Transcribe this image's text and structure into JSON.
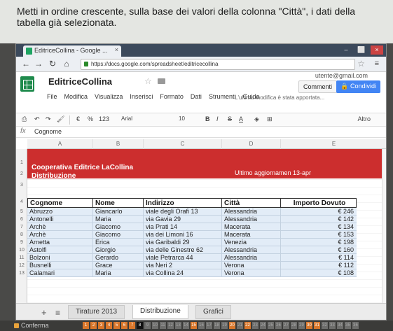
{
  "question": {
    "line1": "Metti in ordine crescente, sulla base dei valori della colonna \"Città\", i dati della",
    "line2": "tabella già selezionata."
  },
  "browser": {
    "tab_title": "EditriceCollina - Google ...",
    "tab_close": "×",
    "url": "https://docs.google.com/spreadsheet/editricecollina",
    "minimize": "–",
    "maximize": "⬜",
    "close": "×"
  },
  "docs": {
    "title": "EditriceCollina",
    "user_email": "utente@gmail.com",
    "comments_label": "Commenti",
    "share_label": "Condividi",
    "menus": [
      "File",
      "Modifica",
      "Visualizza",
      "Inserisci",
      "Formato",
      "Dati",
      "Strumenti",
      "Guida"
    ],
    "last_edit": "L'ultima modifica è stata apportata..."
  },
  "toolbar": {
    "currency": "€",
    "percent": "%",
    "number_format": "123",
    "font": "Arial",
    "size": "10",
    "bold": "B",
    "italic": "I",
    "strike": "S",
    "text_color": "A",
    "more": "Altro"
  },
  "formula_bar": {
    "fx": "fx",
    "value": "Cognome"
  },
  "grid": {
    "columns": [
      "A",
      "B",
      "C",
      "D",
      "E"
    ],
    "row_numbers": [
      "1",
      "2",
      "3",
      "4",
      "5",
      "6",
      "7",
      "8",
      "9",
      "10",
      "11",
      "12",
      "13"
    ],
    "banner_title": "Cooperativa Editrice LaCollina",
    "banner_subtitle": "Distribuzione",
    "banner_date": "Ultimo aggiornamen 13-apr",
    "headers": [
      "Cognome",
      "Nome",
      "Indirizzo",
      "Città",
      "Importo Dovuto"
    ],
    "rows": [
      [
        "Abruzzo",
        "Giancarlo",
        "viale degli Orafi 13",
        "Alessandria",
        "€ 246"
      ],
      [
        "Antonelli",
        "Maria",
        "via Gavia 29",
        "Alessandria",
        "€ 142"
      ],
      [
        "Archè",
        "Giacomo",
        "via Prati 14",
        "Macerata",
        "€ 134"
      ],
      [
        "Archè",
        "Giacomo",
        "via dei Limoni 16",
        "Macerata",
        "€ 153"
      ],
      [
        "Arnetta",
        "Erica",
        "via Garibaldi 29",
        "Venezia",
        "€ 198"
      ],
      [
        "Astolfi",
        "Giorgio",
        "via delle Ginestre 62",
        "Alessandria",
        "€ 160"
      ],
      [
        "Bolzoni",
        "Gerardo",
        "viale Petrarca 44",
        "Alessandria",
        "€ 114"
      ],
      [
        "Busnelli",
        "Grace",
        "via Neri 2",
        "Verona",
        "€ 112"
      ],
      [
        "Calamari",
        "Maria",
        "via Collina 24",
        "Verona",
        "€ 108"
      ]
    ]
  },
  "sheets": {
    "add": "+",
    "list": "≡",
    "tabs": [
      "Tirature 2013",
      "Distribuzione",
      "Grafici"
    ]
  },
  "quiz": {
    "confirm_label": "Conferma",
    "numbers": [
      "1",
      "2",
      "3",
      "4",
      "5",
      "6",
      "7",
      "8",
      "9",
      "10",
      "11",
      "12",
      "13",
      "14",
      "15",
      "16",
      "17",
      "18",
      "19",
      "20",
      "21",
      "22",
      "23",
      "24",
      "25",
      "26",
      "27",
      "28",
      "29",
      "30",
      "31",
      "32",
      "33",
      "34",
      "35",
      "36"
    ]
  }
}
